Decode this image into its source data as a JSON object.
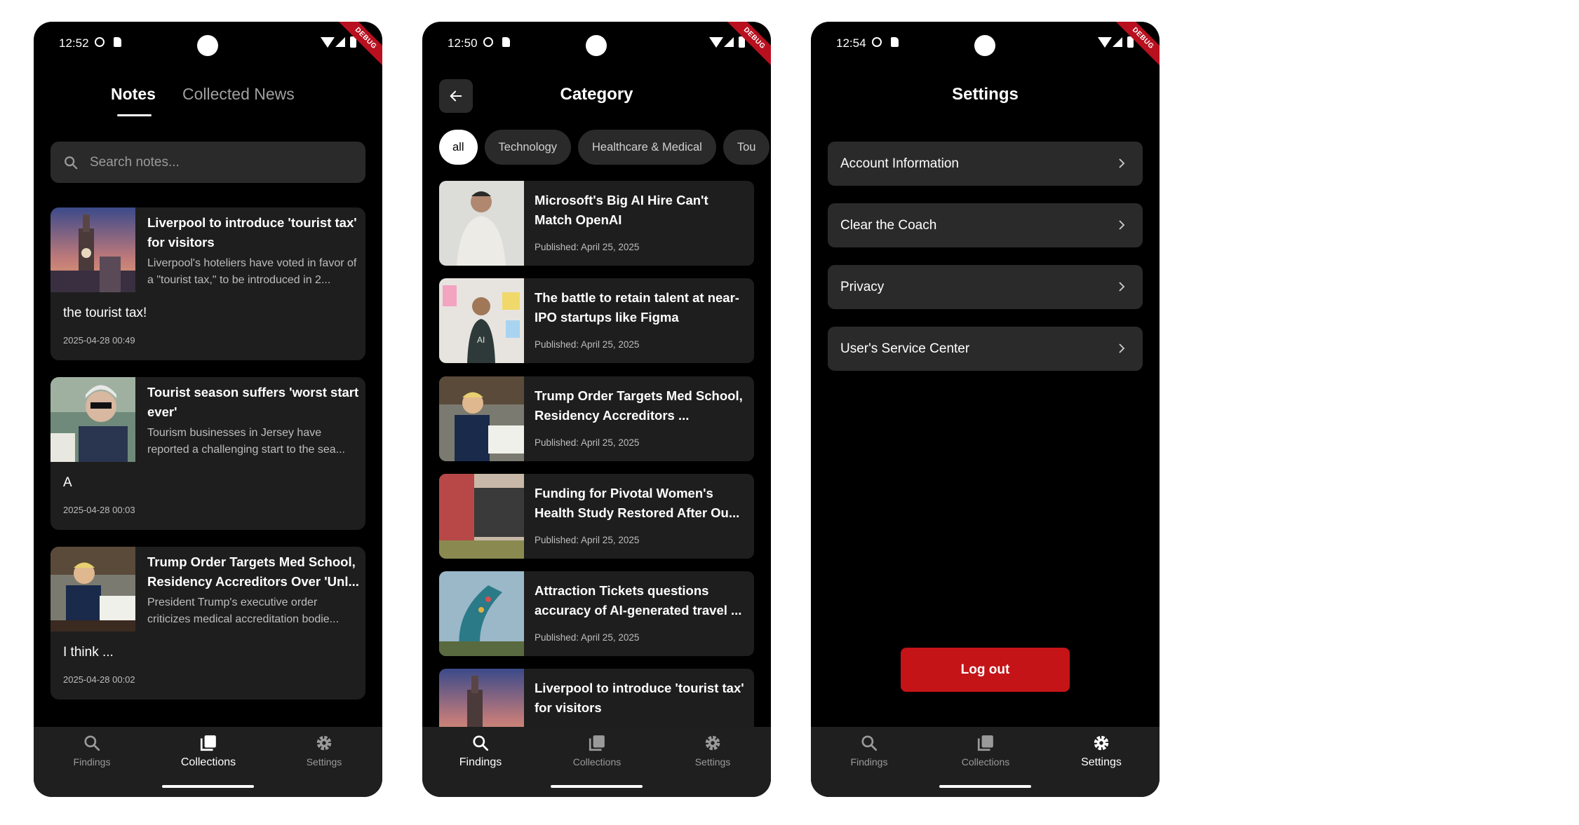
{
  "screens": {
    "notes": {
      "status": {
        "time": "12:52",
        "debug": "DEBUG"
      },
      "tabs": {
        "notes": "Notes",
        "collected_news": "Collected News"
      },
      "search": {
        "placeholder": "Search notes..."
      },
      "items": [
        {
          "title": "Liverpool to introduce 'tourist tax' for visitors",
          "desc": "Liverpool's hoteliers have voted in favor of a \"tourist tax,\" to be introduced in 2...",
          "note": "the tourist tax!",
          "date": "2025-04-28 00:49"
        },
        {
          "title": "Tourist season suffers 'worst start ever'",
          "desc": "Tourism businesses in Jersey have reported a challenging start to the sea...",
          "note": "A",
          "date": "2025-04-28 00:03"
        },
        {
          "title": "Trump Order Targets Med School, Residency Accreditors Over 'Unl...",
          "desc": "President Trump's executive order criticizes medical accreditation bodie...",
          "note": "I think ...",
          "date": "2025-04-28 00:02"
        }
      ]
    },
    "category": {
      "status": {
        "time": "12:50",
        "debug": "DEBUG"
      },
      "title": "Category",
      "chips": [
        "all",
        "Technology",
        "Healthcare & Medical",
        "Tou"
      ],
      "news": [
        {
          "title": "Microsoft's Big AI Hire Can't Match OpenAI",
          "date": "Published: April 25, 2025"
        },
        {
          "title": "The battle to retain talent at near-IPO startups like Figma",
          "date": "Published: April 25, 2025"
        },
        {
          "title": "Trump Order Targets Med School, Residency Accreditors ...",
          "date": "Published: April 25, 2025"
        },
        {
          "title": "Funding for Pivotal Women's Health Study Restored After Ou...",
          "date": "Published: April 25, 2025"
        },
        {
          "title": "Attraction Tickets questions accuracy of AI-generated travel ...",
          "date": "Published: April 25, 2025"
        },
        {
          "title": "Liverpool to introduce 'tourist tax' for visitors",
          "date": ""
        }
      ]
    },
    "settings": {
      "status": {
        "time": "12:54",
        "debug": "DEBUG"
      },
      "title": "Settings",
      "items": [
        "Account Information",
        "Clear the Coach",
        "Privacy",
        "User's Service Center"
      ],
      "logout": "Log out"
    }
  },
  "nav": {
    "findings": "Findings",
    "collections": "Collections",
    "settings": "Settings"
  },
  "icons": {
    "status": [
      "shield-icon",
      "sd-card-icon",
      "wifi-icon",
      "signal-icon",
      "battery-icon"
    ],
    "nav": [
      "search-icon",
      "collections-icon",
      "gear-icon"
    ],
    "back": "arrow-left-icon",
    "chevron": "chevron-right-icon"
  },
  "colors": {
    "background": "#000000",
    "card": "#1e1e1e",
    "accent": "#c41418",
    "muted_text": "#9a9a9a"
  }
}
